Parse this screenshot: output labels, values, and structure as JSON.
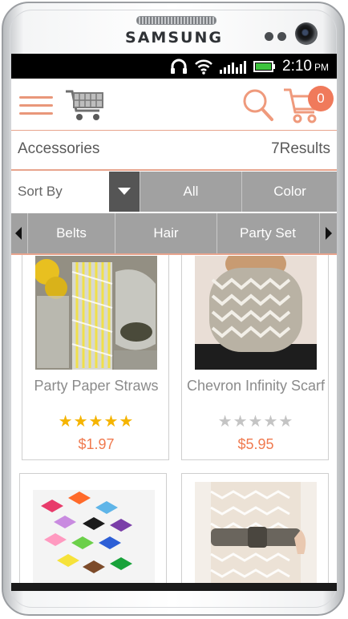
{
  "device": {
    "brand": "SAMSUNG"
  },
  "status_bar": {
    "time": "2:10",
    "ampm": "PM"
  },
  "header": {
    "menu_icon": "hamburger-menu-icon",
    "logo_icon": "shopping-cart-logo-icon",
    "search_icon": "search-icon",
    "cart_icon": "cart-icon",
    "cart_count": "0",
    "accent_color": "#f07a5b"
  },
  "category": {
    "title": "Accessories",
    "results": "7Results"
  },
  "filters": {
    "sort_label": "Sort By",
    "buttons": [
      "All",
      "Color"
    ]
  },
  "subcategories": [
    "Belts",
    "Hair",
    "Party Set"
  ],
  "products": [
    {
      "name": "Party Paper Straws",
      "rating": 5,
      "price": "$1.97"
    },
    {
      "name": "Chevron Infinity Scarf",
      "rating": 0,
      "price": "$5.95"
    },
    {
      "name": "",
      "rating": null,
      "price": ""
    },
    {
      "name": "",
      "rating": null,
      "price": ""
    }
  ]
}
